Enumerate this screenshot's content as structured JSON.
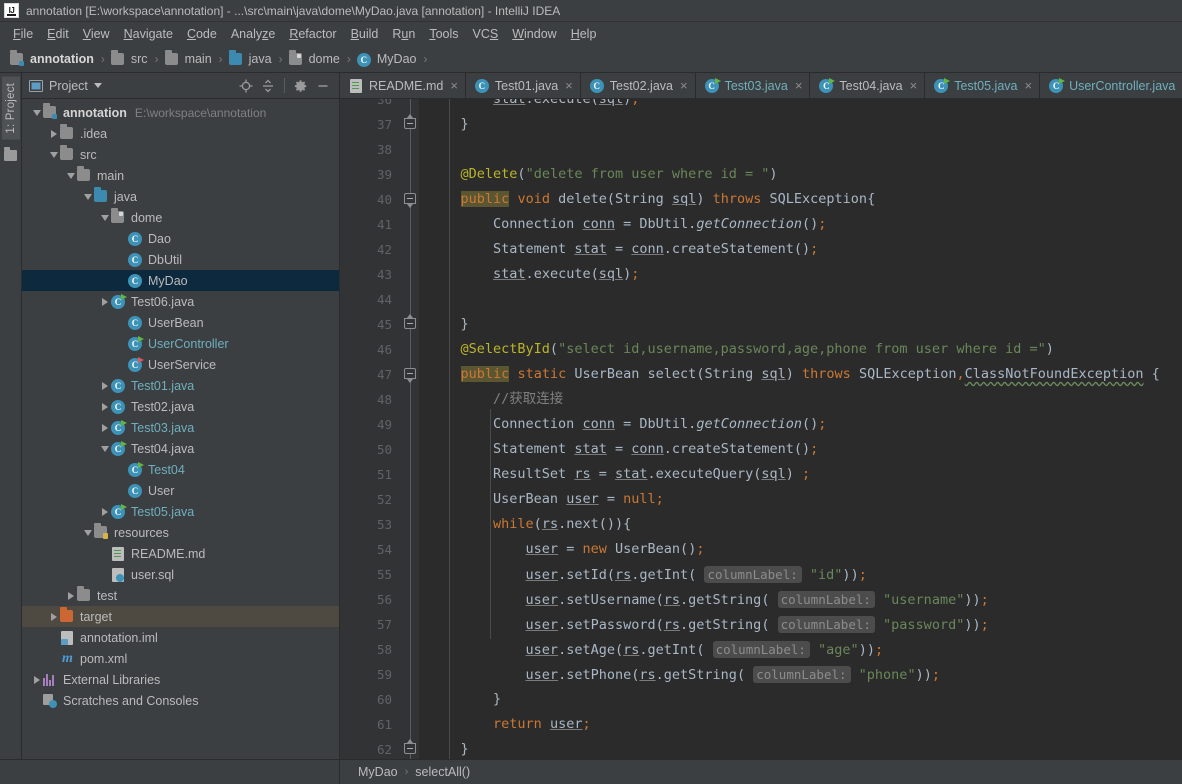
{
  "window": {
    "title": "annotation [E:\\workspace\\annotation] - ...\\src\\main\\java\\dome\\MyDao.java [annotation] - IntelliJ IDEA",
    "logo_icon": "intellij-idea-logo"
  },
  "menubar": {
    "items": [
      {
        "label": "File",
        "mnemonic": "F"
      },
      {
        "label": "Edit",
        "mnemonic": "E"
      },
      {
        "label": "View",
        "mnemonic": "V"
      },
      {
        "label": "Navigate",
        "mnemonic": "N"
      },
      {
        "label": "Code",
        "mnemonic": "C"
      },
      {
        "label": "Analyze",
        "mnemonic": "z"
      },
      {
        "label": "Refactor",
        "mnemonic": "R"
      },
      {
        "label": "Build",
        "mnemonic": "B"
      },
      {
        "label": "Run",
        "mnemonic": "u"
      },
      {
        "label": "Tools",
        "mnemonic": "T"
      },
      {
        "label": "VCS",
        "mnemonic": "S"
      },
      {
        "label": "Window",
        "mnemonic": "W"
      },
      {
        "label": "Help",
        "mnemonic": "H"
      }
    ]
  },
  "navbar": {
    "crumbs": [
      {
        "label": "annotation",
        "icon": "module-icon"
      },
      {
        "label": "src",
        "icon": "folder-icon"
      },
      {
        "label": "main",
        "icon": "folder-icon"
      },
      {
        "label": "java",
        "icon": "source-folder-icon"
      },
      {
        "label": "dome",
        "icon": "package-icon"
      },
      {
        "label": "MyDao",
        "icon": "class-icon"
      }
    ],
    "separator": "›"
  },
  "toolstrip": {
    "tab_label": "1: Project",
    "bottom_icon": "folder-icon"
  },
  "project_panel": {
    "title": "Project",
    "title_icon": "project-view-icon",
    "dropdown_icon": "chevron-down-icon",
    "tools": [
      {
        "name": "locate-icon"
      },
      {
        "name": "collapse-all-icon"
      },
      {
        "name": "gear-icon"
      },
      {
        "name": "minimize-icon"
      }
    ],
    "tree": [
      {
        "depth": 0,
        "arrow": "down",
        "icon": "module-icon",
        "label": "annotation",
        "bold": true,
        "sub": "E:\\workspace\\annotation"
      },
      {
        "depth": 1,
        "arrow": "right",
        "icon": "folder-icon",
        "label": ".idea"
      },
      {
        "depth": 1,
        "arrow": "down",
        "icon": "folder-icon",
        "label": "src"
      },
      {
        "depth": 2,
        "arrow": "down",
        "icon": "folder-icon",
        "label": "main"
      },
      {
        "depth": 3,
        "arrow": "down",
        "icon": "source-folder-icon",
        "label": "java"
      },
      {
        "depth": 4,
        "arrow": "down",
        "icon": "package-icon",
        "label": "dome"
      },
      {
        "depth": 5,
        "arrow": "none",
        "icon": "class-icon",
        "label": "Dao"
      },
      {
        "depth": 5,
        "arrow": "none",
        "icon": "class-icon",
        "label": "DbUtil"
      },
      {
        "depth": 5,
        "arrow": "none",
        "icon": "class-icon",
        "label": "MyDao",
        "selected": true
      },
      {
        "depth": 4,
        "arrow": "right",
        "icon": "runnable-class-icon",
        "label": "Test06.java"
      },
      {
        "depth": 5,
        "arrow": "none",
        "icon": "class-icon",
        "label": "UserBean"
      },
      {
        "depth": 5,
        "arrow": "none",
        "icon": "runnable-class-icon",
        "label": "UserController",
        "teal": true
      },
      {
        "depth": 5,
        "arrow": "none",
        "icon": "runnable-class-red-icon",
        "label": "UserService"
      },
      {
        "depth": 4,
        "arrow": "right",
        "icon": "class-icon",
        "label": "Test01.java",
        "teal": true
      },
      {
        "depth": 4,
        "arrow": "right",
        "icon": "class-icon",
        "label": "Test02.java"
      },
      {
        "depth": 4,
        "arrow": "right",
        "icon": "runnable-class-icon",
        "label": "Test03.java",
        "teal": true
      },
      {
        "depth": 4,
        "arrow": "down",
        "icon": "runnable-class-icon",
        "label": "Test04.java"
      },
      {
        "depth": 5,
        "arrow": "none",
        "icon": "runnable-class-icon",
        "label": "Test04",
        "teal": true
      },
      {
        "depth": 5,
        "arrow": "none",
        "icon": "class-icon",
        "label": "User"
      },
      {
        "depth": 4,
        "arrow": "right",
        "icon": "runnable-class-icon",
        "label": "Test05.java",
        "teal": true
      },
      {
        "depth": 3,
        "arrow": "down",
        "icon": "resource-folder-icon",
        "label": "resources"
      },
      {
        "depth": 4,
        "arrow": "none",
        "icon": "markdown-icon",
        "label": "README.md"
      },
      {
        "depth": 4,
        "arrow": "none",
        "icon": "sql-icon",
        "label": "user.sql"
      },
      {
        "depth": 2,
        "arrow": "right",
        "icon": "folder-icon",
        "label": "test"
      },
      {
        "depth": 1,
        "arrow": "right",
        "icon": "excluded-folder-icon",
        "label": "target",
        "hover": true
      },
      {
        "depth": 1,
        "arrow": "none",
        "icon": "iml-icon",
        "label": "annotation.iml"
      },
      {
        "depth": 1,
        "arrow": "none",
        "icon": "maven-icon",
        "label": "pom.xml"
      },
      {
        "depth": 0,
        "arrow": "right",
        "icon": "library-icon",
        "label": "External Libraries"
      },
      {
        "depth": 0,
        "arrow": "none",
        "icon": "scratches-icon",
        "label": "Scratches and Consoles"
      }
    ]
  },
  "editor_tabs": [
    {
      "label": "README.md",
      "icon": "markdown-icon",
      "active": false,
      "close": "×"
    },
    {
      "label": "Test01.java",
      "icon": "class-icon",
      "active": false,
      "close": "×"
    },
    {
      "label": "Test02.java",
      "icon": "class-icon",
      "active": false,
      "close": "×"
    },
    {
      "label": "Test03.java",
      "icon": "runnable-class-icon",
      "active": false,
      "teal": true,
      "close": "×"
    },
    {
      "label": "Test04.java",
      "icon": "runnable-class-icon",
      "active": false,
      "close": "×"
    },
    {
      "label": "Test05.java",
      "icon": "runnable-class-icon",
      "active": false,
      "teal": true,
      "close": "×"
    },
    {
      "label": "UserController.java",
      "icon": "runnable-class-icon",
      "active": false,
      "teal": true,
      "close": "×"
    }
  ],
  "code": {
    "first_line_number": 36,
    "lines": [
      {
        "n": 36,
        "text": "        stat.execute(sql);",
        "clipped": true
      },
      {
        "n": 37,
        "text": "    }",
        "fold": "end"
      },
      {
        "n": 38,
        "text": ""
      },
      {
        "n": 39,
        "text": "    @Delete(\"delete from user where id = \")"
      },
      {
        "n": 40,
        "text": "    public void delete(String sql) throws SQLException{",
        "fold": "start"
      },
      {
        "n": 41,
        "text": "        Connection conn = DbUtil.getConnection();"
      },
      {
        "n": 42,
        "text": "        Statement stat = conn.createStatement();"
      },
      {
        "n": 43,
        "text": "        stat.execute(sql);"
      },
      {
        "n": 44,
        "text": ""
      },
      {
        "n": 45,
        "text": "    }",
        "fold": "end"
      },
      {
        "n": 46,
        "text": "    @SelectById(\"select id,username,password,age,phone from user where id =\")"
      },
      {
        "n": 47,
        "text": "    public static UserBean select(String sql) throws SQLException,ClassNotFoundException {",
        "fold": "start"
      },
      {
        "n": 48,
        "text": "        //获取连接"
      },
      {
        "n": 49,
        "text": "        Connection conn = DbUtil.getConnection();"
      },
      {
        "n": 50,
        "text": "        Statement stat = conn.createStatement();"
      },
      {
        "n": 51,
        "text": "        ResultSet rs = stat.executeQuery(sql) ;"
      },
      {
        "n": 52,
        "text": "        UserBean user = null;"
      },
      {
        "n": 53,
        "text": "        while(rs.next()){"
      },
      {
        "n": 54,
        "text": "            user = new UserBean();"
      },
      {
        "n": 55,
        "text": "            user.setId(rs.getInt( columnLabel: \"id\"));"
      },
      {
        "n": 56,
        "text": "            user.setUsername(rs.getString( columnLabel: \"username\"));"
      },
      {
        "n": 57,
        "text": "            user.setPassword(rs.getString( columnLabel: \"password\"));"
      },
      {
        "n": 58,
        "text": "            user.setAge(rs.getInt( columnLabel: \"age\"));"
      },
      {
        "n": 59,
        "text": "            user.setPhone(rs.getString( columnLabel: \"phone\"));"
      },
      {
        "n": 60,
        "text": "        }"
      },
      {
        "n": 61,
        "text": "        return user;"
      },
      {
        "n": 62,
        "text": "    }",
        "fold": "end"
      }
    ],
    "parameter_hint_label": "columnLabel:",
    "highlighted_identifier": "public"
  },
  "statusbar": {
    "crumbs": [
      "MyDao",
      "selectAll()"
    ],
    "separator": "›"
  },
  "colors": {
    "background": "#3c3f41",
    "editor_background": "#2b2b2b",
    "gutter_background": "#313335",
    "selection": "#0d293e",
    "keyword": "#cc7832",
    "string": "#6a8759",
    "annotation": "#bbb529",
    "comment": "#808080",
    "text": "#a9b7c6",
    "accent_teal": "#6fafbd",
    "excluded_orange": "#cc6633"
  }
}
